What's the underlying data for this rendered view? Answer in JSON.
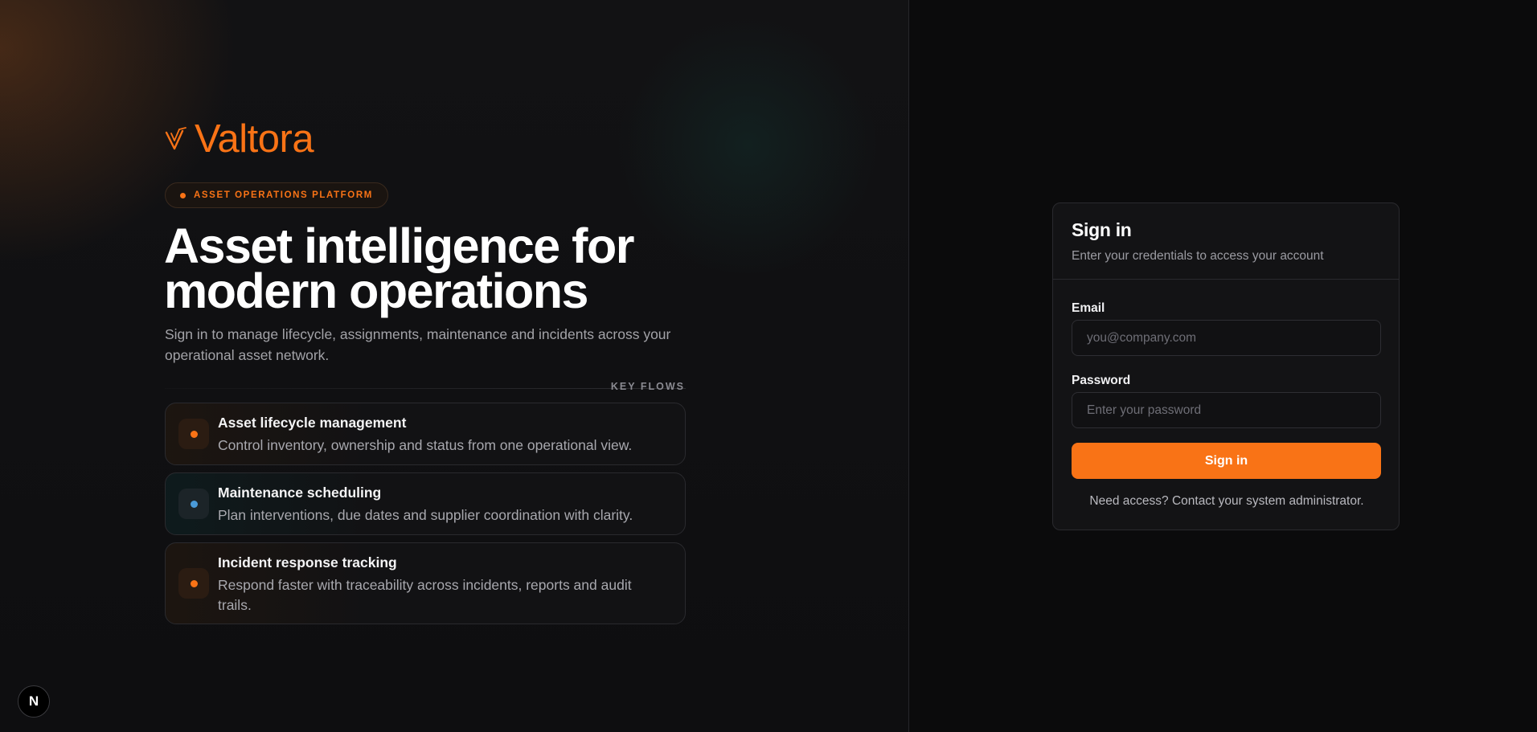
{
  "brand": {
    "name": "Valtora",
    "accent": "#f97316"
  },
  "hero": {
    "badge": "ASSET OPERATIONS PLATFORM",
    "headline_line1": "Asset intelligence for",
    "headline_line2": "modern operations",
    "subtext": "Sign in to manage lifecycle, assignments, maintenance and incidents across your operational asset network."
  },
  "flows": {
    "label": "KEY FLOWS",
    "items": [
      {
        "title": "Asset lifecycle management",
        "description": "Control inventory, ownership and status from one operational view.",
        "icon": "orange-dot-icon",
        "accent": "#f97316"
      },
      {
        "title": "Maintenance scheduling",
        "description": "Plan interventions, due dates and supplier coordination with clarity.",
        "icon": "blue-dot-icon",
        "accent": "#4a9ad8"
      },
      {
        "title": "Incident response tracking",
        "description": "Respond faster with traceability across incidents, reports and audit trails.",
        "icon": "orange-dot-icon",
        "accent": "#f97316"
      }
    ]
  },
  "signin": {
    "title": "Sign in",
    "subtitle": "Enter your credentials to access your account",
    "email_label": "Email",
    "email_placeholder": "you@company.com",
    "password_label": "Password",
    "password_placeholder": "Enter your password",
    "submit_label": "Sign in",
    "help_text": "Need access? Contact your system administrator."
  },
  "corner_badge": {
    "letter": "N",
    "icon": "nextjs-icon"
  }
}
